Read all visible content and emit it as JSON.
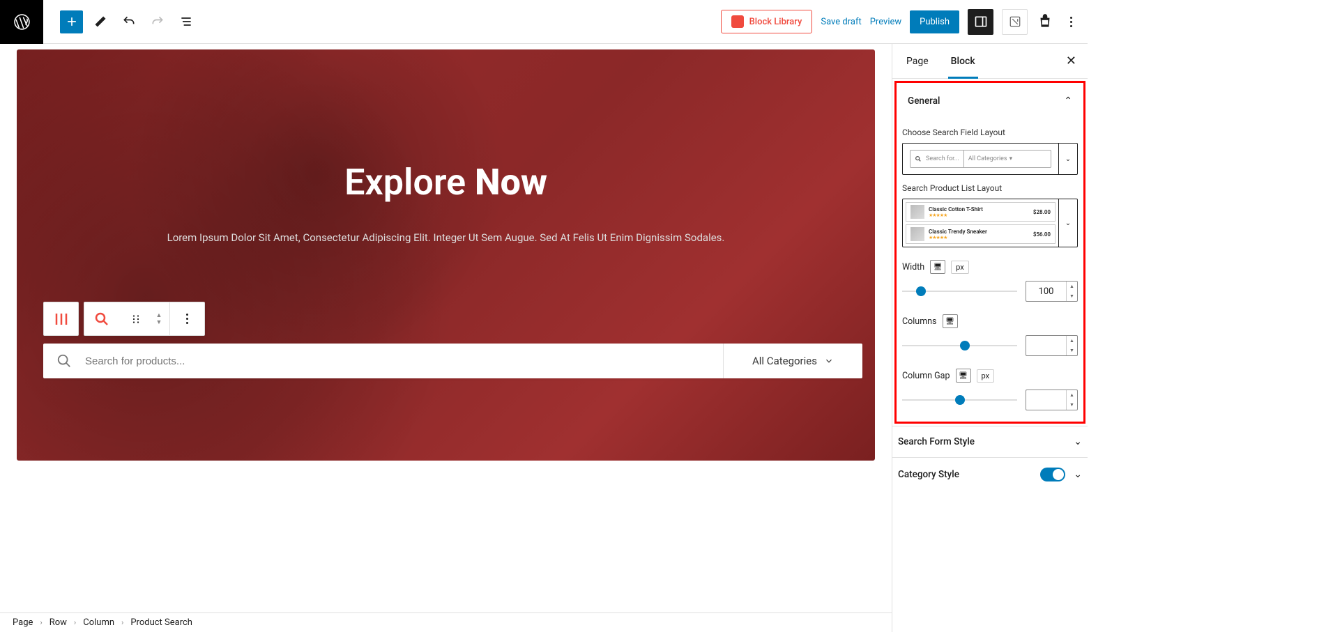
{
  "toolbar": {
    "block_library": "Block Library",
    "save_draft": "Save draft",
    "preview": "Preview",
    "publish": "Publish"
  },
  "hero": {
    "title_a": "Explore",
    "title_b": "Now",
    "subtitle": "Lorem Ipsum Dolor Sit Amet, Consectetur Adipiscing Elit. Integer Ut Sem Augue. Sed At Felis Ut Enim Dignissim Sodales."
  },
  "search_block": {
    "placeholder": "Search for products...",
    "category": "All Categories"
  },
  "breadcrumb": [
    "Page",
    "Row",
    "Column",
    "Product Search"
  ],
  "sidebar": {
    "tabs": {
      "page": "Page",
      "block": "Block"
    },
    "panels": {
      "general": {
        "title": "General",
        "choose_layout": "Choose Search Field Layout",
        "search_preview_placeholder": "Search for...",
        "search_preview_cat": "All Categories",
        "list_layout": "Search Product List Layout",
        "products": [
          {
            "name": "Classic Cotton T-Shirt",
            "price": "$28.00"
          },
          {
            "name": "Classic Trendy Sneaker",
            "price": "$56.00"
          }
        ],
        "width_label": "Width",
        "width_unit": "px",
        "width_value": "100",
        "columns_label": "Columns",
        "gap_label": "Column Gap",
        "gap_unit": "px"
      },
      "search_form_style": "Search Form Style",
      "category_style": "Category Style"
    }
  }
}
